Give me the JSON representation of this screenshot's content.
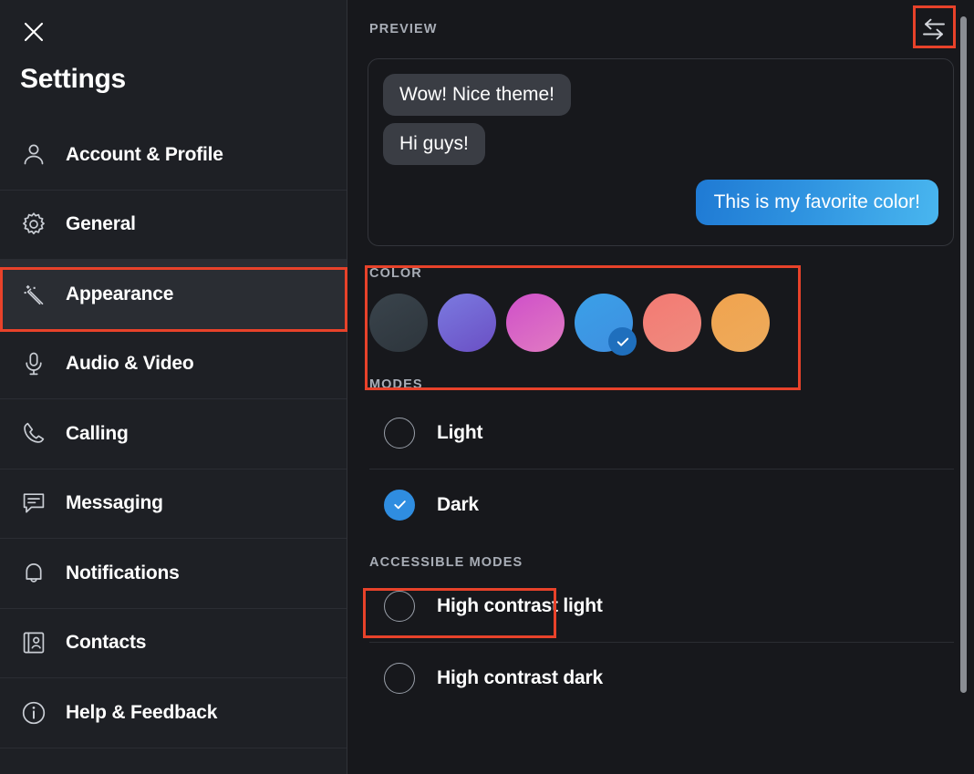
{
  "sidebar": {
    "close_icon": "close-icon",
    "title": "Settings",
    "items": [
      {
        "label": "Account & Profile",
        "icon": "person-icon",
        "active": false
      },
      {
        "label": "General",
        "icon": "gear-icon",
        "active": false
      },
      {
        "label": "Appearance",
        "icon": "magic-wand-icon",
        "active": true
      },
      {
        "label": "Audio & Video",
        "icon": "microphone-icon",
        "active": false
      },
      {
        "label": "Calling",
        "icon": "phone-icon",
        "active": false
      },
      {
        "label": "Messaging",
        "icon": "chat-bubble-icon",
        "active": false
      },
      {
        "label": "Notifications",
        "icon": "bell-icon",
        "active": false
      },
      {
        "label": "Contacts",
        "icon": "contact-book-icon",
        "active": false
      },
      {
        "label": "Help & Feedback",
        "icon": "info-icon",
        "active": false
      }
    ]
  },
  "main": {
    "preview": {
      "header": "PREVIEW",
      "swap_icon": "swap-arrows-icon",
      "messages": [
        {
          "text": "Wow! Nice theme!",
          "direction": "incoming"
        },
        {
          "text": "Hi guys!",
          "direction": "incoming"
        },
        {
          "text": "This is my favorite color!",
          "direction": "outgoing"
        }
      ],
      "incoming_bubble_color": "#3a3d44",
      "outgoing_bubble_color_start": "#1f7ad4",
      "outgoing_bubble_color_end": "#49b6ef"
    },
    "color": {
      "header": "COLOR",
      "selected_index": 3,
      "check_icon": "checkmark-icon",
      "swatches": [
        {
          "name": "slate",
          "start": "#3a444c",
          "end": "#2d353c",
          "selected": false
        },
        {
          "name": "purple",
          "start": "#7b7ae0",
          "end": "#6a4fc4",
          "selected": false
        },
        {
          "name": "pink",
          "start": "#cf4fc9",
          "end": "#e17bc2",
          "selected": false
        },
        {
          "name": "blue",
          "start": "#3aa0e8",
          "end": "#3f8fe0",
          "selected": true
        },
        {
          "name": "salmon",
          "start": "#f37a73",
          "end": "#ef8b7f",
          "selected": false
        },
        {
          "name": "orange",
          "start": "#f0a34e",
          "end": "#eeab5c",
          "selected": false
        }
      ]
    },
    "modes": {
      "header": "MODES",
      "options": [
        {
          "label": "Light",
          "selected": false
        },
        {
          "label": "Dark",
          "selected": true
        }
      ]
    },
    "accessible_modes": {
      "header": "ACCESSIBLE MODES",
      "options": [
        {
          "label": "High contrast light",
          "selected": false
        },
        {
          "label": "High contrast dark",
          "selected": false
        }
      ]
    },
    "scrollbar": {
      "name": "vertical-scrollbar"
    }
  },
  "annotations": {
    "color": "#e8422a",
    "boxes": [
      "appearance-nav-item",
      "color-section",
      "accessible-modes-header",
      "swap-preview-button"
    ]
  }
}
